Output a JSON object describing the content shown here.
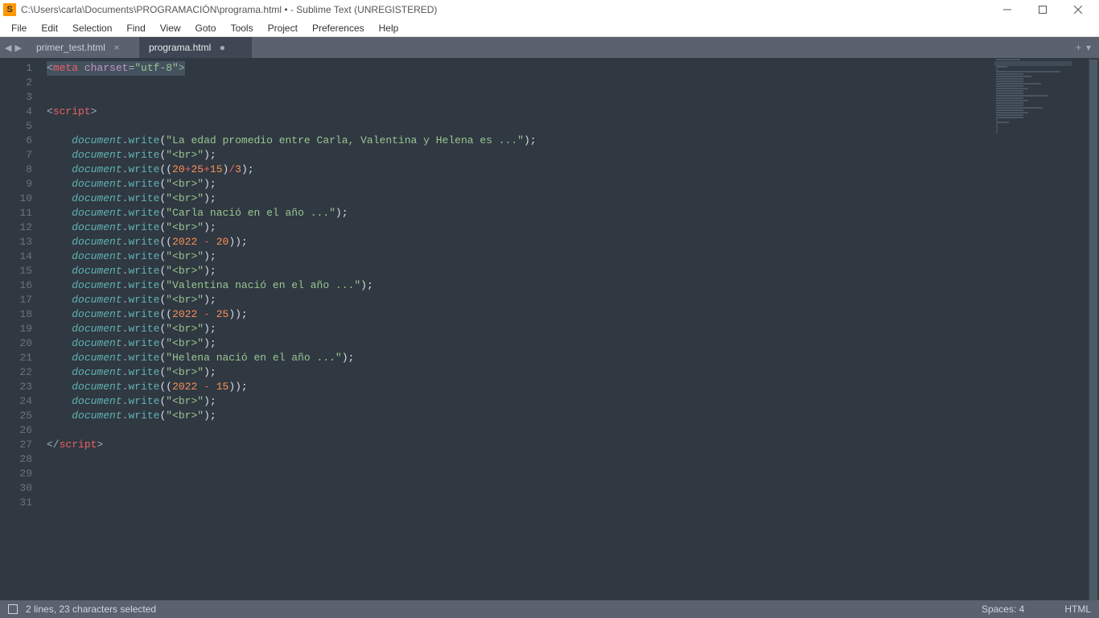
{
  "window": {
    "title": "C:\\Users\\carla\\Documents\\PROGRAMACIÓN\\programa.html • - Sublime Text (UNREGISTERED)",
    "app_icon_letter": "S"
  },
  "menu": {
    "items": [
      "File",
      "Edit",
      "Selection",
      "Find",
      "View",
      "Goto",
      "Tools",
      "Project",
      "Preferences",
      "Help"
    ]
  },
  "tabs": {
    "nav_back": "◀",
    "nav_fwd": "▶",
    "items": [
      {
        "label": "primer_test.html",
        "active": false,
        "dirty": false
      },
      {
        "label": "programa.html",
        "active": true,
        "dirty": true
      }
    ],
    "close_glyph": "×",
    "dirty_glyph": "●",
    "plus_glyph": "+",
    "menu_glyph": "▾"
  },
  "gutter": {
    "start": 1,
    "end": 31
  },
  "code": {
    "lines": [
      [
        {
          "t": "<",
          "c": "angle"
        },
        {
          "t": "meta ",
          "c": "tag"
        },
        {
          "t": "charset",
          "c": "attr"
        },
        {
          "t": "=",
          "c": "op"
        },
        {
          "t": "\"utf-8\"",
          "c": "str"
        },
        {
          "t": ">",
          "c": "angle"
        }
      ],
      [],
      [],
      [
        {
          "t": "<",
          "c": "angle"
        },
        {
          "t": "script",
          "c": "tag"
        },
        {
          "t": ">",
          "c": "angle"
        }
      ],
      [],
      [
        {
          "t": "    ",
          "c": "punc"
        },
        {
          "t": "document",
          "c": "obj"
        },
        {
          "t": ".",
          "c": "dot"
        },
        {
          "t": "write",
          "c": "func"
        },
        {
          "t": "(",
          "c": "punc"
        },
        {
          "t": "\"La edad promedio entre Carla, Valentina y Helena es ...\"",
          "c": "str"
        },
        {
          "t": ")",
          "c": "punc"
        },
        {
          "t": ";",
          "c": "punc"
        }
      ],
      [
        {
          "t": "    ",
          "c": "punc"
        },
        {
          "t": "document",
          "c": "obj"
        },
        {
          "t": ".",
          "c": "dot"
        },
        {
          "t": "write",
          "c": "func"
        },
        {
          "t": "(",
          "c": "punc"
        },
        {
          "t": "\"<br>\"",
          "c": "str"
        },
        {
          "t": ")",
          "c": "punc"
        },
        {
          "t": ";",
          "c": "punc"
        }
      ],
      [
        {
          "t": "    ",
          "c": "punc"
        },
        {
          "t": "document",
          "c": "obj"
        },
        {
          "t": ".",
          "c": "dot"
        },
        {
          "t": "write",
          "c": "func"
        },
        {
          "t": "((",
          "c": "punc"
        },
        {
          "t": "20",
          "c": "num"
        },
        {
          "t": "+",
          "c": "kwd"
        },
        {
          "t": "25",
          "c": "num"
        },
        {
          "t": "+",
          "c": "kwd"
        },
        {
          "t": "15",
          "c": "num"
        },
        {
          "t": ")",
          "c": "punc"
        },
        {
          "t": "/",
          "c": "kwd"
        },
        {
          "t": "3",
          "c": "num"
        },
        {
          "t": ")",
          "c": "punc"
        },
        {
          "t": ";",
          "c": "punc"
        }
      ],
      [
        {
          "t": "    ",
          "c": "punc"
        },
        {
          "t": "document",
          "c": "obj"
        },
        {
          "t": ".",
          "c": "dot"
        },
        {
          "t": "write",
          "c": "func"
        },
        {
          "t": "(",
          "c": "punc"
        },
        {
          "t": "\"<br>\"",
          "c": "str"
        },
        {
          "t": ")",
          "c": "punc"
        },
        {
          "t": ";",
          "c": "punc"
        }
      ],
      [
        {
          "t": "    ",
          "c": "punc"
        },
        {
          "t": "document",
          "c": "obj"
        },
        {
          "t": ".",
          "c": "dot"
        },
        {
          "t": "write",
          "c": "func"
        },
        {
          "t": "(",
          "c": "punc"
        },
        {
          "t": "\"<br>\"",
          "c": "str"
        },
        {
          "t": ")",
          "c": "punc"
        },
        {
          "t": ";",
          "c": "punc"
        }
      ],
      [
        {
          "t": "    ",
          "c": "punc"
        },
        {
          "t": "document",
          "c": "obj"
        },
        {
          "t": ".",
          "c": "dot"
        },
        {
          "t": "write",
          "c": "func"
        },
        {
          "t": "(",
          "c": "punc"
        },
        {
          "t": "\"Carla nació en el año ...\"",
          "c": "str"
        },
        {
          "t": ")",
          "c": "punc"
        },
        {
          "t": ";",
          "c": "punc"
        }
      ],
      [
        {
          "t": "    ",
          "c": "punc"
        },
        {
          "t": "document",
          "c": "obj"
        },
        {
          "t": ".",
          "c": "dot"
        },
        {
          "t": "write",
          "c": "func"
        },
        {
          "t": "(",
          "c": "punc"
        },
        {
          "t": "\"<br>\"",
          "c": "str"
        },
        {
          "t": ")",
          "c": "punc"
        },
        {
          "t": ";",
          "c": "punc"
        }
      ],
      [
        {
          "t": "    ",
          "c": "punc"
        },
        {
          "t": "document",
          "c": "obj"
        },
        {
          "t": ".",
          "c": "dot"
        },
        {
          "t": "write",
          "c": "func"
        },
        {
          "t": "((",
          "c": "punc"
        },
        {
          "t": "2022",
          "c": "num"
        },
        {
          "t": " - ",
          "c": "kwd"
        },
        {
          "t": "20",
          "c": "num"
        },
        {
          "t": "))",
          "c": "punc"
        },
        {
          "t": ";",
          "c": "punc"
        }
      ],
      [
        {
          "t": "    ",
          "c": "punc"
        },
        {
          "t": "document",
          "c": "obj"
        },
        {
          "t": ".",
          "c": "dot"
        },
        {
          "t": "write",
          "c": "func"
        },
        {
          "t": "(",
          "c": "punc"
        },
        {
          "t": "\"<br>\"",
          "c": "str"
        },
        {
          "t": ")",
          "c": "punc"
        },
        {
          "t": ";",
          "c": "punc"
        }
      ],
      [
        {
          "t": "    ",
          "c": "punc"
        },
        {
          "t": "document",
          "c": "obj"
        },
        {
          "t": ".",
          "c": "dot"
        },
        {
          "t": "write",
          "c": "func"
        },
        {
          "t": "(",
          "c": "punc"
        },
        {
          "t": "\"<br>\"",
          "c": "str"
        },
        {
          "t": ")",
          "c": "punc"
        },
        {
          "t": ";",
          "c": "punc"
        }
      ],
      [
        {
          "t": "    ",
          "c": "punc"
        },
        {
          "t": "document",
          "c": "obj"
        },
        {
          "t": ".",
          "c": "dot"
        },
        {
          "t": "write",
          "c": "func"
        },
        {
          "t": "(",
          "c": "punc"
        },
        {
          "t": "\"Valentina nació en el año ...\"",
          "c": "str"
        },
        {
          "t": ")",
          "c": "punc"
        },
        {
          "t": ";",
          "c": "punc"
        }
      ],
      [
        {
          "t": "    ",
          "c": "punc"
        },
        {
          "t": "document",
          "c": "obj"
        },
        {
          "t": ".",
          "c": "dot"
        },
        {
          "t": "write",
          "c": "func"
        },
        {
          "t": "(",
          "c": "punc"
        },
        {
          "t": "\"<br>\"",
          "c": "str"
        },
        {
          "t": ")",
          "c": "punc"
        },
        {
          "t": ";",
          "c": "punc"
        }
      ],
      [
        {
          "t": "    ",
          "c": "punc"
        },
        {
          "t": "document",
          "c": "obj"
        },
        {
          "t": ".",
          "c": "dot"
        },
        {
          "t": "write",
          "c": "func"
        },
        {
          "t": "((",
          "c": "punc"
        },
        {
          "t": "2022",
          "c": "num"
        },
        {
          "t": " - ",
          "c": "kwd"
        },
        {
          "t": "25",
          "c": "num"
        },
        {
          "t": "))",
          "c": "punc"
        },
        {
          "t": ";",
          "c": "punc"
        }
      ],
      [
        {
          "t": "    ",
          "c": "punc"
        },
        {
          "t": "document",
          "c": "obj"
        },
        {
          "t": ".",
          "c": "dot"
        },
        {
          "t": "write",
          "c": "func"
        },
        {
          "t": "(",
          "c": "punc"
        },
        {
          "t": "\"<br>\"",
          "c": "str"
        },
        {
          "t": ")",
          "c": "punc"
        },
        {
          "t": ";",
          "c": "punc"
        }
      ],
      [
        {
          "t": "    ",
          "c": "punc"
        },
        {
          "t": "document",
          "c": "obj"
        },
        {
          "t": ".",
          "c": "dot"
        },
        {
          "t": "write",
          "c": "func"
        },
        {
          "t": "(",
          "c": "punc"
        },
        {
          "t": "\"<br>\"",
          "c": "str"
        },
        {
          "t": ")",
          "c": "punc"
        },
        {
          "t": ";",
          "c": "punc"
        }
      ],
      [
        {
          "t": "    ",
          "c": "punc"
        },
        {
          "t": "document",
          "c": "obj"
        },
        {
          "t": ".",
          "c": "dot"
        },
        {
          "t": "write",
          "c": "func"
        },
        {
          "t": "(",
          "c": "punc"
        },
        {
          "t": "\"Helena nació en el año ...\"",
          "c": "str"
        },
        {
          "t": ")",
          "c": "punc"
        },
        {
          "t": ";",
          "c": "punc"
        }
      ],
      [
        {
          "t": "    ",
          "c": "punc"
        },
        {
          "t": "document",
          "c": "obj"
        },
        {
          "t": ".",
          "c": "dot"
        },
        {
          "t": "write",
          "c": "func"
        },
        {
          "t": "(",
          "c": "punc"
        },
        {
          "t": "\"<br>\"",
          "c": "str"
        },
        {
          "t": ")",
          "c": "punc"
        },
        {
          "t": ";",
          "c": "punc"
        }
      ],
      [
        {
          "t": "    ",
          "c": "punc"
        },
        {
          "t": "document",
          "c": "obj"
        },
        {
          "t": ".",
          "c": "dot"
        },
        {
          "t": "write",
          "c": "func"
        },
        {
          "t": "((",
          "c": "punc"
        },
        {
          "t": "2022",
          "c": "num"
        },
        {
          "t": " - ",
          "c": "kwd"
        },
        {
          "t": "15",
          "c": "num"
        },
        {
          "t": "))",
          "c": "punc"
        },
        {
          "t": ";",
          "c": "punc"
        }
      ],
      [
        {
          "t": "    ",
          "c": "punc"
        },
        {
          "t": "document",
          "c": "obj"
        },
        {
          "t": ".",
          "c": "dot"
        },
        {
          "t": "write",
          "c": "func"
        },
        {
          "t": "(",
          "c": "punc"
        },
        {
          "t": "\"<br>\"",
          "c": "str"
        },
        {
          "t": ")",
          "c": "punc"
        },
        {
          "t": ";",
          "c": "punc"
        }
      ],
      [
        {
          "t": "    ",
          "c": "punc"
        },
        {
          "t": "document",
          "c": "obj"
        },
        {
          "t": ".",
          "c": "dot"
        },
        {
          "t": "write",
          "c": "func"
        },
        {
          "t": "(",
          "c": "punc"
        },
        {
          "t": "\"<br>\"",
          "c": "str"
        },
        {
          "t": ")",
          "c": "punc"
        },
        {
          "t": ";",
          "c": "punc"
        }
      ],
      [],
      [
        {
          "t": "</",
          "c": "angle"
        },
        {
          "t": "script",
          "c": "tag"
        },
        {
          "t": ">",
          "c": "angle"
        }
      ],
      [],
      [],
      [],
      []
    ],
    "selection_lines": [
      0,
      1
    ]
  },
  "statusbar": {
    "selection": "2 lines, 23 characters selected",
    "spaces": "Spaces: 4",
    "syntax": "HTML"
  }
}
